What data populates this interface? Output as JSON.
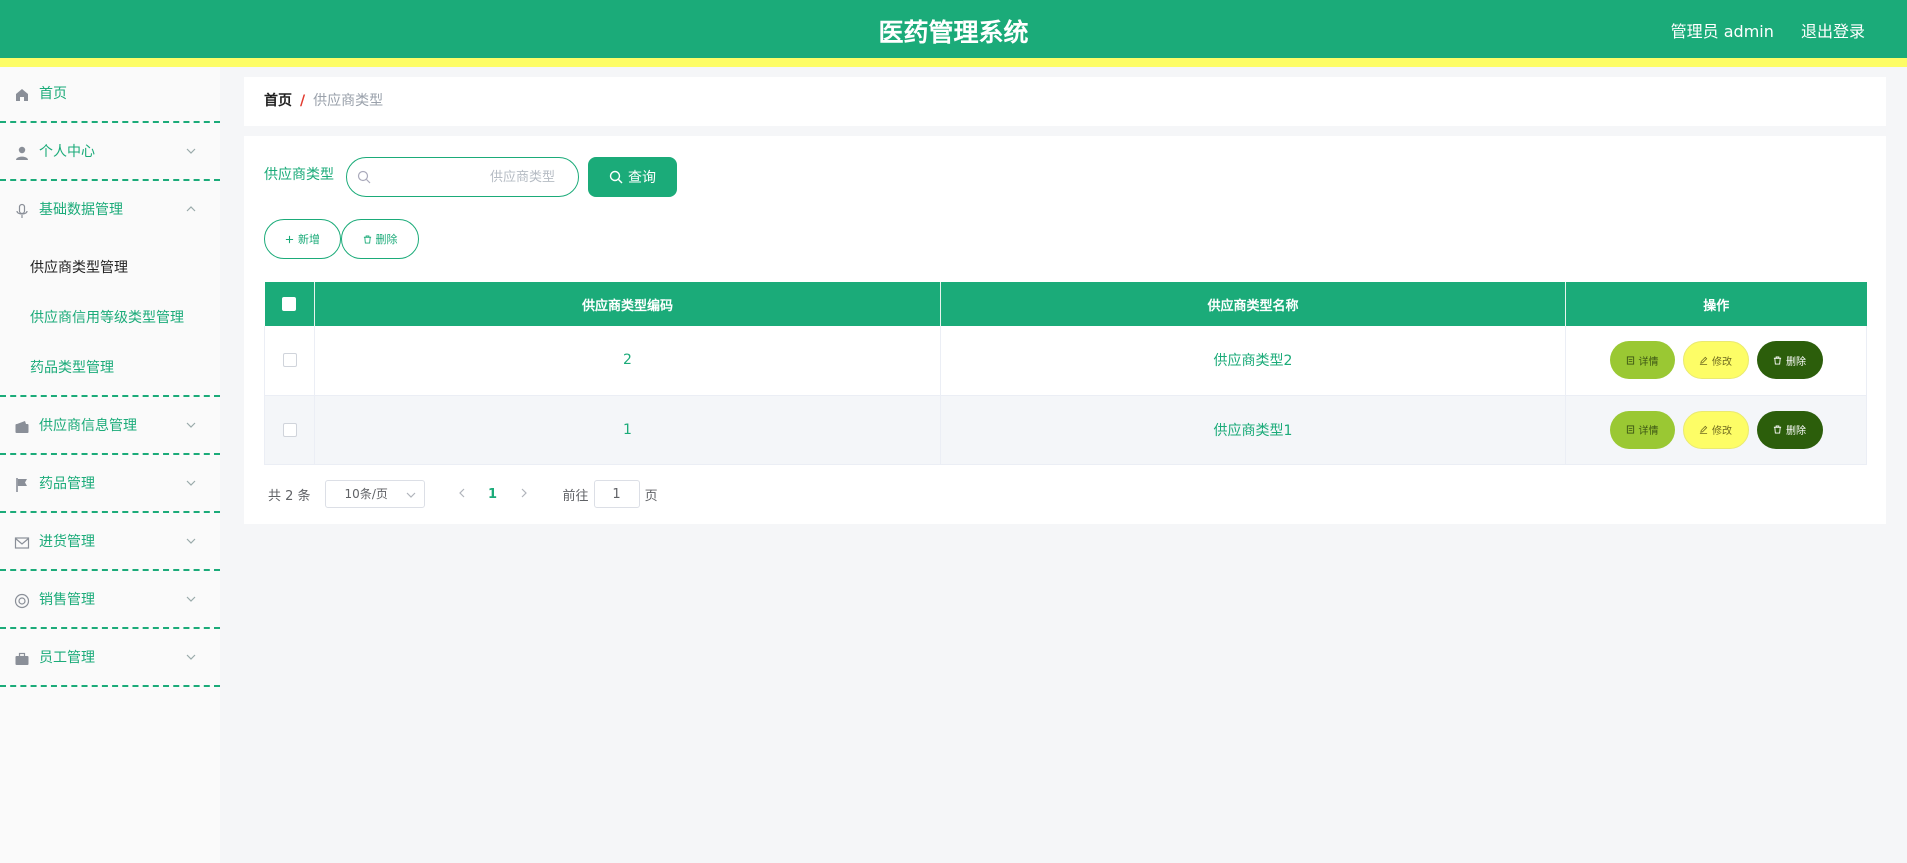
{
  "header": {
    "title": "医药管理系统",
    "user_label": "管理员 admin",
    "logout_label": "退出登录"
  },
  "sidebar": {
    "home": "首页",
    "personal": "个人中心",
    "basic_data": {
      "label": "基础数据管理",
      "children": [
        "供应商类型管理",
        "供应商信用等级类型管理",
        "药品类型管理"
      ]
    },
    "supplier_info": "供应商信息管理",
    "drug": "药品管理",
    "purchase": "进货管理",
    "sales": "销售管理",
    "staff": "员工管理"
  },
  "breadcrumb": {
    "home": "首页",
    "separator": "/",
    "current": "供应商类型"
  },
  "search": {
    "label": "供应商类型",
    "placeholder": "供应商类型",
    "value": "",
    "button_label": "查询"
  },
  "actions": {
    "add_label": "新增",
    "delete_label": "删除"
  },
  "table": {
    "columns": [
      "供应商类型编码",
      "供应商类型名称",
      "操作"
    ],
    "rows": [
      {
        "code": "2",
        "name": "供应商类型2"
      },
      {
        "code": "1",
        "name": "供应商类型1"
      }
    ],
    "row_actions": {
      "detail": "详情",
      "edit": "修改",
      "delete": "删除"
    }
  },
  "pagination": {
    "total_label": "共 2 条",
    "page_size": "10条/页",
    "current_page": "1",
    "goto_label": "前往",
    "goto_value": "1",
    "page_suffix": "页"
  },
  "colors": {
    "primary": "#1bab79",
    "accent_yellow": "#fdfd66",
    "detail_green": "#9ac833",
    "delete_dark_green": "#2c5e0b"
  }
}
